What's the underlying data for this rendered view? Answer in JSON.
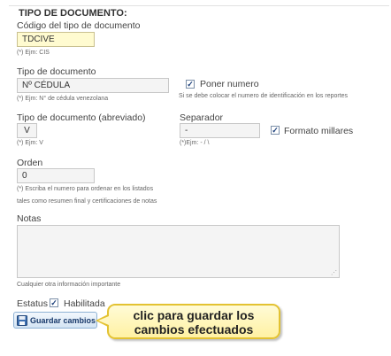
{
  "section": {
    "title": "TIPO DE DOCUMENTO:"
  },
  "codigo": {
    "label": "Código del tipo de documento",
    "value": "TDCIVE",
    "hint": "(*) Ejm: CIS"
  },
  "tipo": {
    "label": "Tipo de documento",
    "value": "Nº CÉDULA",
    "hint": "(*) Ejm: N° de cédula venezolana"
  },
  "poner_numero": {
    "label": "Poner numero",
    "checked": true,
    "hint": "Si se debe colocar el numero de identificación en los reportes"
  },
  "tipo_abrev": {
    "label": "Tipo de documento (abreviado)",
    "value": "V",
    "hint": "(*) Ejm: V"
  },
  "separador": {
    "label": "Separador",
    "value": "-",
    "hint": "(*)Ejm: - / \\"
  },
  "formato_millares": {
    "label": "Formato millares",
    "checked": true
  },
  "orden": {
    "label": "Orden",
    "value": "0",
    "hint_line1": "(*) Escriba el numero para ordenar en los listados",
    "hint_line2": "tales como resumen final y certificaciones de notas"
  },
  "notas": {
    "label": "Notas",
    "value": "",
    "hint": "Cualquier otra información importante"
  },
  "estatus": {
    "label": "Estatus",
    "habilitada_label": "Habilitada",
    "checked": true
  },
  "save_button": {
    "label": "Guardar cambios",
    "icon": "save-disk-icon"
  },
  "callout": {
    "line1": "clic para guardar los",
    "line2": "cambios efectuados"
  },
  "colors": {
    "active_input": "#fffbd0",
    "callout_bg": "#fff1a3",
    "callout_border": "#e3c232",
    "button_text": "#17386a"
  }
}
